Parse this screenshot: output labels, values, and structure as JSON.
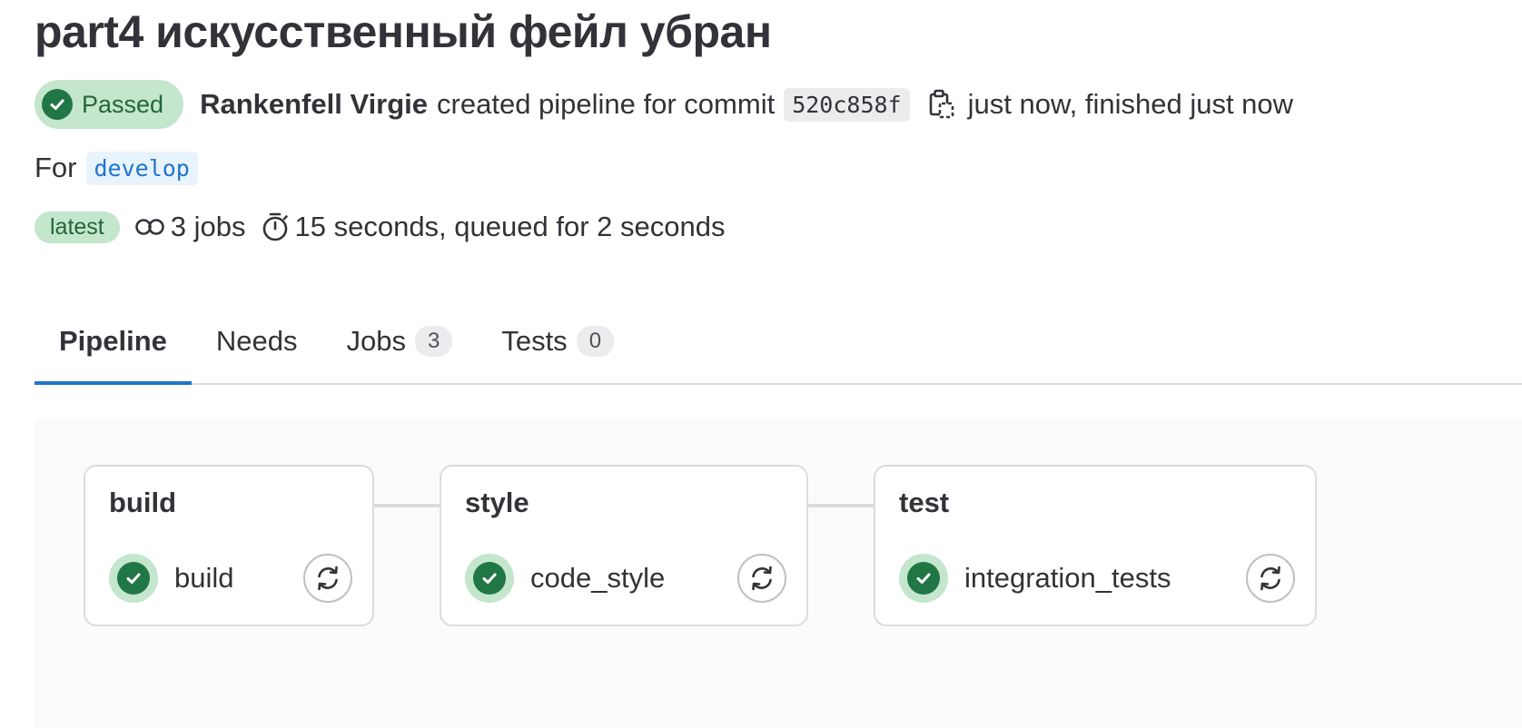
{
  "pipeline": {
    "title": "part4 искусственный фейл убран",
    "status": "Passed",
    "author": "Rankenfell Virgie",
    "action_text": "created pipeline for commit",
    "commit_sha": "520c858f",
    "timing_text": "just now, finished just now",
    "for_label": "For",
    "ref": "develop",
    "latest_label": "latest",
    "jobs_text": "3 jobs",
    "duration_text": "15 seconds, queued for 2 seconds"
  },
  "tabs": [
    {
      "label": "Pipeline",
      "active": true
    },
    {
      "label": "Needs"
    },
    {
      "label": "Jobs",
      "count": "3"
    },
    {
      "label": "Tests",
      "count": "0"
    }
  ],
  "stages": [
    {
      "name": "build",
      "jobs": [
        {
          "name": "build",
          "status": "success"
        }
      ]
    },
    {
      "name": "style",
      "jobs": [
        {
          "name": "code_style",
          "status": "success"
        }
      ]
    },
    {
      "name": "test",
      "jobs": [
        {
          "name": "integration_tests",
          "status": "success"
        }
      ]
    }
  ],
  "colors": {
    "success": "#217645",
    "success_bg": "#c3e6cd",
    "accent": "#1f75cb"
  },
  "icons": {
    "status": "check-circle-icon",
    "copy": "copy-to-clipboard-icon",
    "jobs": "pipeline-jobs-icon",
    "duration": "stopwatch-icon",
    "retry": "retry-icon"
  }
}
